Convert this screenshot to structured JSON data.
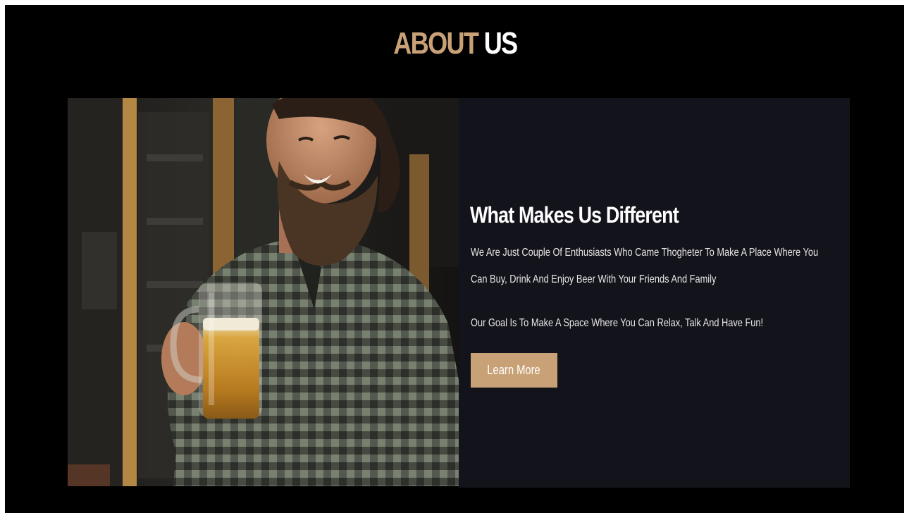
{
  "section": {
    "title_accent": "ABOUT",
    "title_main": "US"
  },
  "about": {
    "heading": "What Makes Us Different",
    "paragraph_1": "We Are Just Couple Of Enthusiasts Who Came Thogheter To Make A Place Where You Can Buy, Drink And Enjoy Beer With Your Friends And Family",
    "paragraph_2": "Our Goal Is To Make A Space Where You Can Relax, Talk And Have Fun!",
    "button_label": "Learn More"
  },
  "colors": {
    "background": "#000000",
    "panel": "#13131b",
    "accent": "#c9a176",
    "text": "#ffffff"
  }
}
